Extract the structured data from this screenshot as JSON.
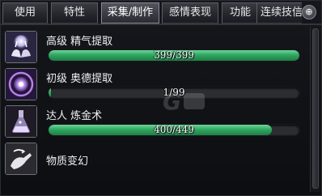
{
  "tabs": [
    {
      "label": "使用",
      "active": false
    },
    {
      "label": "特性",
      "active": false
    },
    {
      "label": "采集/制作",
      "active": true
    },
    {
      "label": "感情表现",
      "active": false
    },
    {
      "label": "功能",
      "active": false
    },
    {
      "label": "连续技信息",
      "active": false
    }
  ],
  "tab_next_icon": "⊕",
  "skills": [
    {
      "name": "高级 精气提取",
      "icon": "hands-glow-icon",
      "progress": {
        "text": "399/399",
        "fraction": 1.0
      }
    },
    {
      "name": "初级 奥德提取",
      "icon": "odd-orb-icon",
      "progress": {
        "text": "1/99",
        "fraction": 0.0101
      }
    },
    {
      "name": "达人 炼金术",
      "icon": "alchemy-flask-icon",
      "progress": {
        "text": "400/449",
        "fraction": 0.8909
      }
    },
    {
      "name": "物质变幻",
      "icon": "transform-hand-icon",
      "progress": null
    }
  ],
  "colors": {
    "bar_fill": "#2fa861",
    "bar_track": "#2b2d31",
    "active_tab": "#53565e"
  }
}
